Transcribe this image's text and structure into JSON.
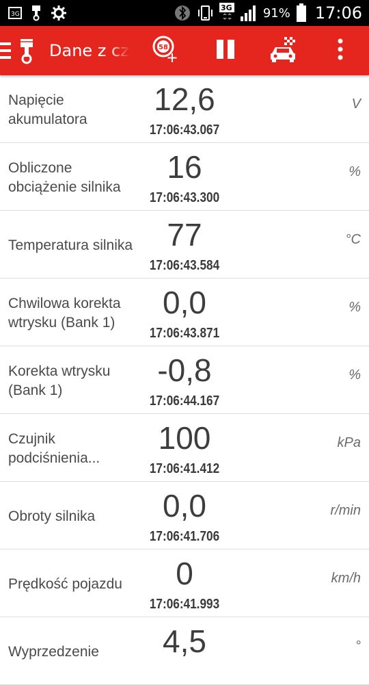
{
  "status_bar": {
    "battery_percent": "91%",
    "time": "17:06",
    "network_type": "3G",
    "icons": [
      "3g-notification-icon",
      "piston-notification-icon",
      "gear-notification-icon",
      "bluetooth-icon",
      "vibrate-icon",
      "3g-data-icon",
      "signal-icon",
      "battery-icon"
    ]
  },
  "app_bar": {
    "title": "Dane z czujników",
    "speed_badge": "58",
    "icons": [
      "menu-icon",
      "app-logo-piston-icon",
      "add-gauge-icon",
      "pause-icon",
      "race-car-icon",
      "more-options-icon"
    ]
  },
  "readings": [
    {
      "label": "Napięcie akumulatora",
      "value": "12,6",
      "time": "17:06:43.067",
      "unit": "V"
    },
    {
      "label": "Obliczone obciążenie silnika",
      "value": "16",
      "time": "17:06:43.300",
      "unit": "%"
    },
    {
      "label": "Temperatura silnika",
      "value": "77",
      "time": "17:06:43.584",
      "unit": "°C"
    },
    {
      "label": "Chwilowa korekta wtrysku (Bank 1)",
      "value": "0,0",
      "time": "17:06:43.871",
      "unit": "%"
    },
    {
      "label": "Korekta wtrysku (Bank 1)",
      "value": "-0,8",
      "time": "17:06:44.167",
      "unit": "%"
    },
    {
      "label": "Czujnik podciśnienia...",
      "value": "100",
      "time": "17:06:41.412",
      "unit": "kPa"
    },
    {
      "label": "Obroty silnika",
      "value": "0,0",
      "time": "17:06:41.706",
      "unit": "r/min"
    },
    {
      "label": "Prędkość pojazdu",
      "value": "0",
      "time": "17:06:41.993",
      "unit": "km/h"
    },
    {
      "label": "Wyprzedzenie",
      "value": "4,5",
      "time": "",
      "unit": "°"
    }
  ],
  "colors": {
    "accent": "#e5261f",
    "status_bar": "#000000",
    "text": "#3d3d3d",
    "divider": "#dddddd"
  }
}
